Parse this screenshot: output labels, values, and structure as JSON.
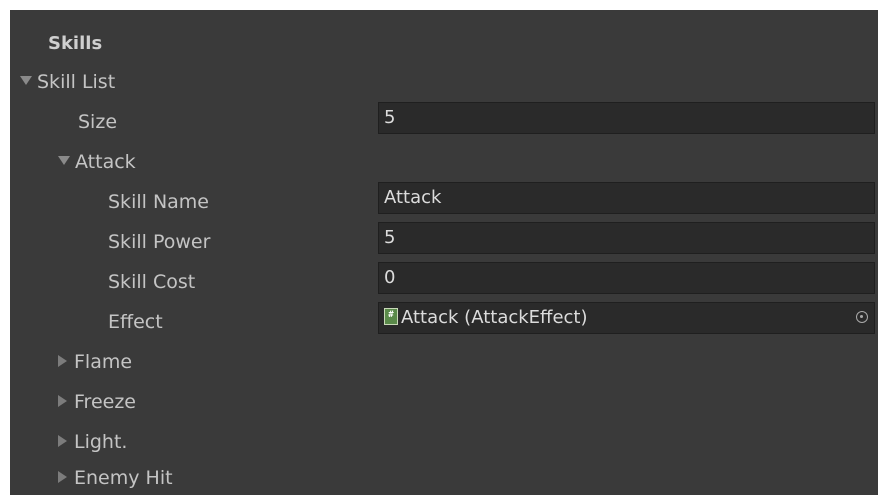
{
  "inspector": {
    "header": "Skills",
    "skill_list_label": "Skill List",
    "size_label": "Size",
    "size_value": "5",
    "attack": {
      "label": "Attack",
      "fields": {
        "skill_name_label": "Skill Name",
        "skill_name_value": "Attack",
        "skill_power_label": "Skill Power",
        "skill_power_value": "5",
        "skill_cost_label": "Skill Cost",
        "skill_cost_value": "0",
        "effect_label": "Effect",
        "effect_value": "Attack (AttackEffect)"
      }
    },
    "collapsed_items": [
      "Flame",
      "Freeze",
      "Light.",
      "Enemy Hit"
    ],
    "icons": {
      "expanded": "triangle-down-icon",
      "collapsed": "triangle-right-icon",
      "script": "script-icon",
      "object_picker": "object-picker-icon"
    },
    "colors": {
      "panel_bg": "#3a3a3a",
      "field_bg": "#2a2a2a",
      "text": "#c4c4c4"
    }
  }
}
